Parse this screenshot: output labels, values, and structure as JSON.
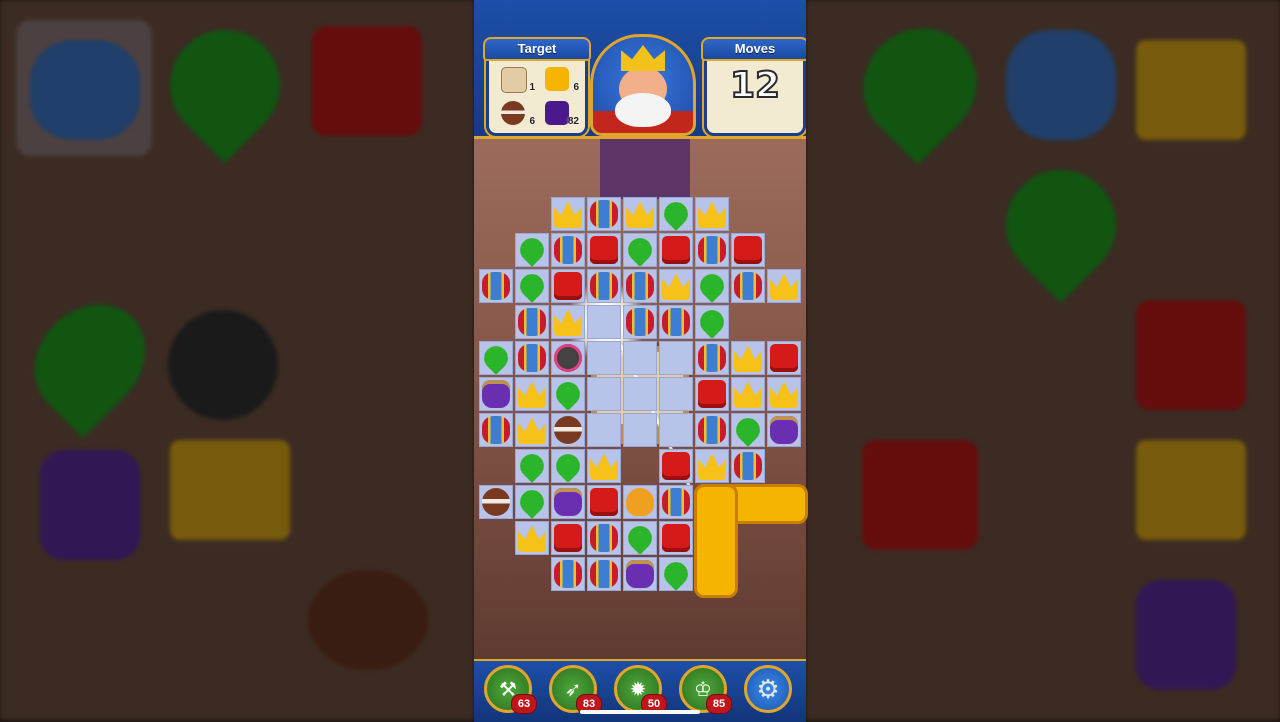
{
  "hud": {
    "target_label": "Target",
    "moves_label": "Moves",
    "moves_value": "12",
    "targets": [
      {
        "icon": "map-scroll-icon",
        "count": "1",
        "color": "#e3cba3"
      },
      {
        "icon": "honey-tile-icon",
        "count": "6",
        "color": "#f5b400"
      },
      {
        "icon": "clay-pot-icon",
        "count": "6",
        "color": "#7a3a22"
      },
      {
        "icon": "purple-tile-icon",
        "count": "82",
        "color": "#4a1a8a"
      }
    ]
  },
  "boosters": [
    {
      "icon": "hammer-booster-icon",
      "count": "63",
      "glyph": "⚒"
    },
    {
      "icon": "arrow-booster-icon",
      "count": "83",
      "glyph": "➶"
    },
    {
      "icon": "cannon-booster-icon",
      "count": "50",
      "glyph": "✹"
    },
    {
      "icon": "jester-hat-booster-icon",
      "count": "85",
      "glyph": "♔"
    }
  ],
  "settings_icon": "gear-icon",
  "colors": {
    "hud_blue": "#1d4fa8",
    "gold": "#e0a62b",
    "board_cell": "#b7c3e8"
  }
}
